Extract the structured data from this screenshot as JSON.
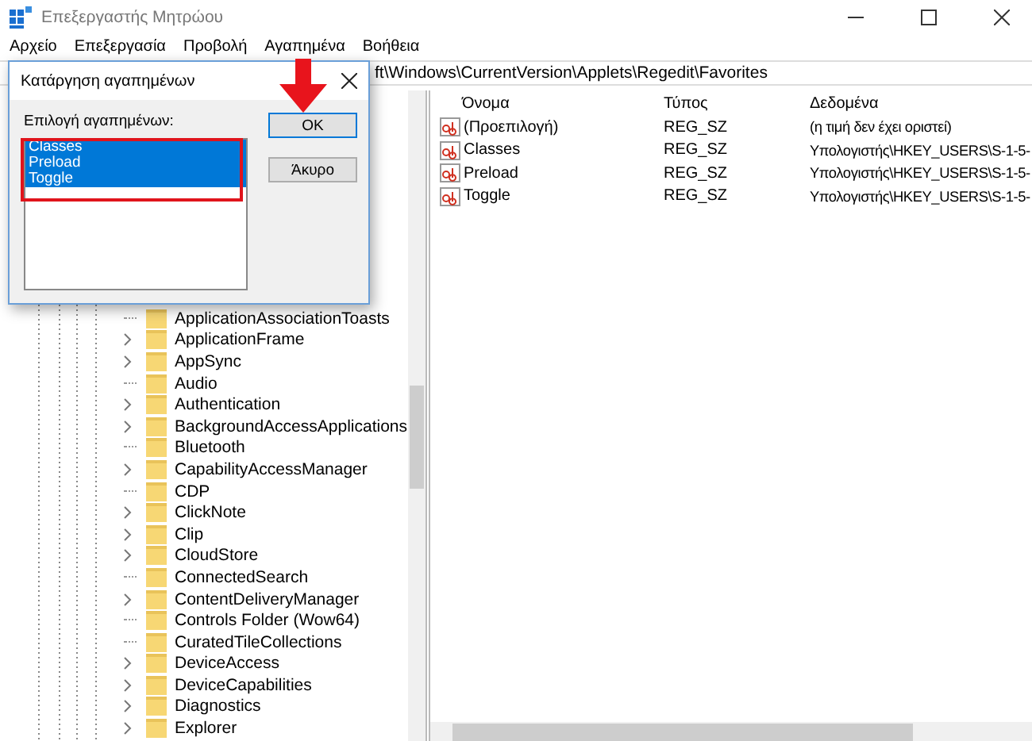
{
  "window": {
    "title": "Επεξεργαστής Μητρώου"
  },
  "menu": [
    "Αρχείο",
    "Επεξεργασία",
    "Προβολή",
    "Αγαπημένα",
    "Βοήθεια"
  ],
  "address_bar": {
    "value": "ft\\Windows\\CurrentVersion\\Applets\\Regedit\\Favorites"
  },
  "tree": {
    "items": [
      {
        "label": "ApplicationAssociationToasts",
        "kind": "leaf"
      },
      {
        "label": "ApplicationFrame",
        "kind": "branch"
      },
      {
        "label": "AppSync",
        "kind": "branch"
      },
      {
        "label": "Audio",
        "kind": "leaf"
      },
      {
        "label": "Authentication",
        "kind": "branch"
      },
      {
        "label": "BackgroundAccessApplications",
        "kind": "branch"
      },
      {
        "label": "Bluetooth",
        "kind": "leaf"
      },
      {
        "label": "CapabilityAccessManager",
        "kind": "branch"
      },
      {
        "label": "CDP",
        "kind": "leaf"
      },
      {
        "label": "ClickNote",
        "kind": "branch"
      },
      {
        "label": "Clip",
        "kind": "branch"
      },
      {
        "label": "CloudStore",
        "kind": "branch"
      },
      {
        "label": "ConnectedSearch",
        "kind": "leaf"
      },
      {
        "label": "ContentDeliveryManager",
        "kind": "branch"
      },
      {
        "label": "Controls Folder (Wow64)",
        "kind": "leaf"
      },
      {
        "label": "CuratedTileCollections",
        "kind": "leaf"
      },
      {
        "label": "DeviceAccess",
        "kind": "branch"
      },
      {
        "label": "DeviceCapabilities",
        "kind": "branch"
      },
      {
        "label": "Diagnostics",
        "kind": "branch"
      },
      {
        "label": "Explorer",
        "kind": "branch"
      }
    ]
  },
  "values": {
    "columns": [
      "Όνομα",
      "Τύπος",
      "Δεδομένα"
    ],
    "rows": [
      {
        "name": "(Προεπιλογή)",
        "type": "REG_SZ",
        "data": "(η τιμή δεν έχει οριστεί)"
      },
      {
        "name": "Classes",
        "type": "REG_SZ",
        "data": "Υπολογιστής\\HKEY_USERS\\S-1-5-"
      },
      {
        "name": "Preload",
        "type": "REG_SZ",
        "data": "Υπολογιστής\\HKEY_USERS\\S-1-5-"
      },
      {
        "name": "Toggle",
        "type": "REG_SZ",
        "data": "Υπολογιστής\\HKEY_USERS\\S-1-5-"
      }
    ]
  },
  "dialog": {
    "title": "Κατάργηση αγαπημένων",
    "label": "Επιλογή αγαπημένων:",
    "items": [
      {
        "label": "Classes",
        "selected": true
      },
      {
        "label": "Preload",
        "selected": true
      },
      {
        "label": "Toggle",
        "selected": true
      }
    ],
    "buttons": [
      "OK",
      "Άκυρο"
    ]
  }
}
